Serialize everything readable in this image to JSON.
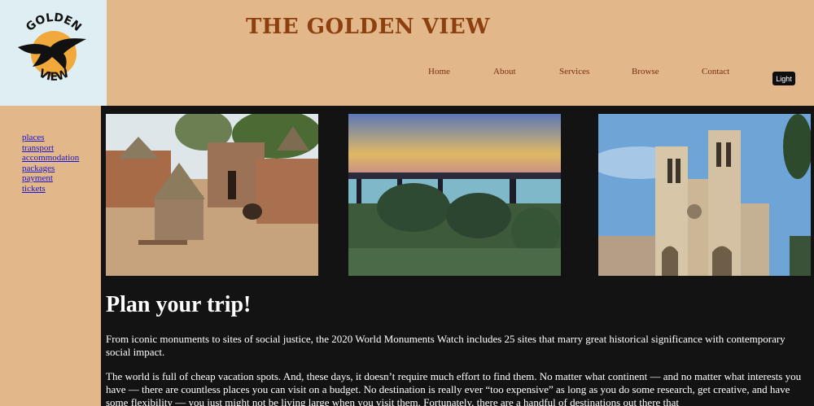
{
  "logo": {
    "top_text": "GOLDEN",
    "bottom_text": "VIEW"
  },
  "header": {
    "title": "THE GOLDEN VIEW"
  },
  "nav": {
    "items": [
      "Home",
      "About",
      "Services",
      "Browse",
      "Contact"
    ]
  },
  "theme_toggle": {
    "label": "Light"
  },
  "sidebar": {
    "links": [
      "places",
      "transport",
      "accommodation",
      "packages",
      "payment",
      "tickets"
    ]
  },
  "gallery": {
    "photos": [
      "village-huts-photo",
      "bridge-at-sunset-photo",
      "cathedral-photo"
    ]
  },
  "main": {
    "heading": "Plan your trip!",
    "paragraph1": "From iconic monuments to sites of social justice, the 2020 World Monuments Watch includes 25 sites that marry great historical significance with contemporary social impact.",
    "paragraph2": "The world is full of cheap vacation spots. And, these days, it doesn’t require much effort to find them. No matter what continent — and no matter what interests you have — there are countless places you can visit on a budget. No destination is really ever “too expensive” as long as you do some research, get creative, and have some flexibility — you just might not be living large when you visit them. Fortunately, there are a handful of destinations out there that"
  },
  "colors": {
    "header_bg": "#e2b88a",
    "title": "#8e3f0f",
    "page_bg": "#141314",
    "link": "#1c14c6"
  }
}
